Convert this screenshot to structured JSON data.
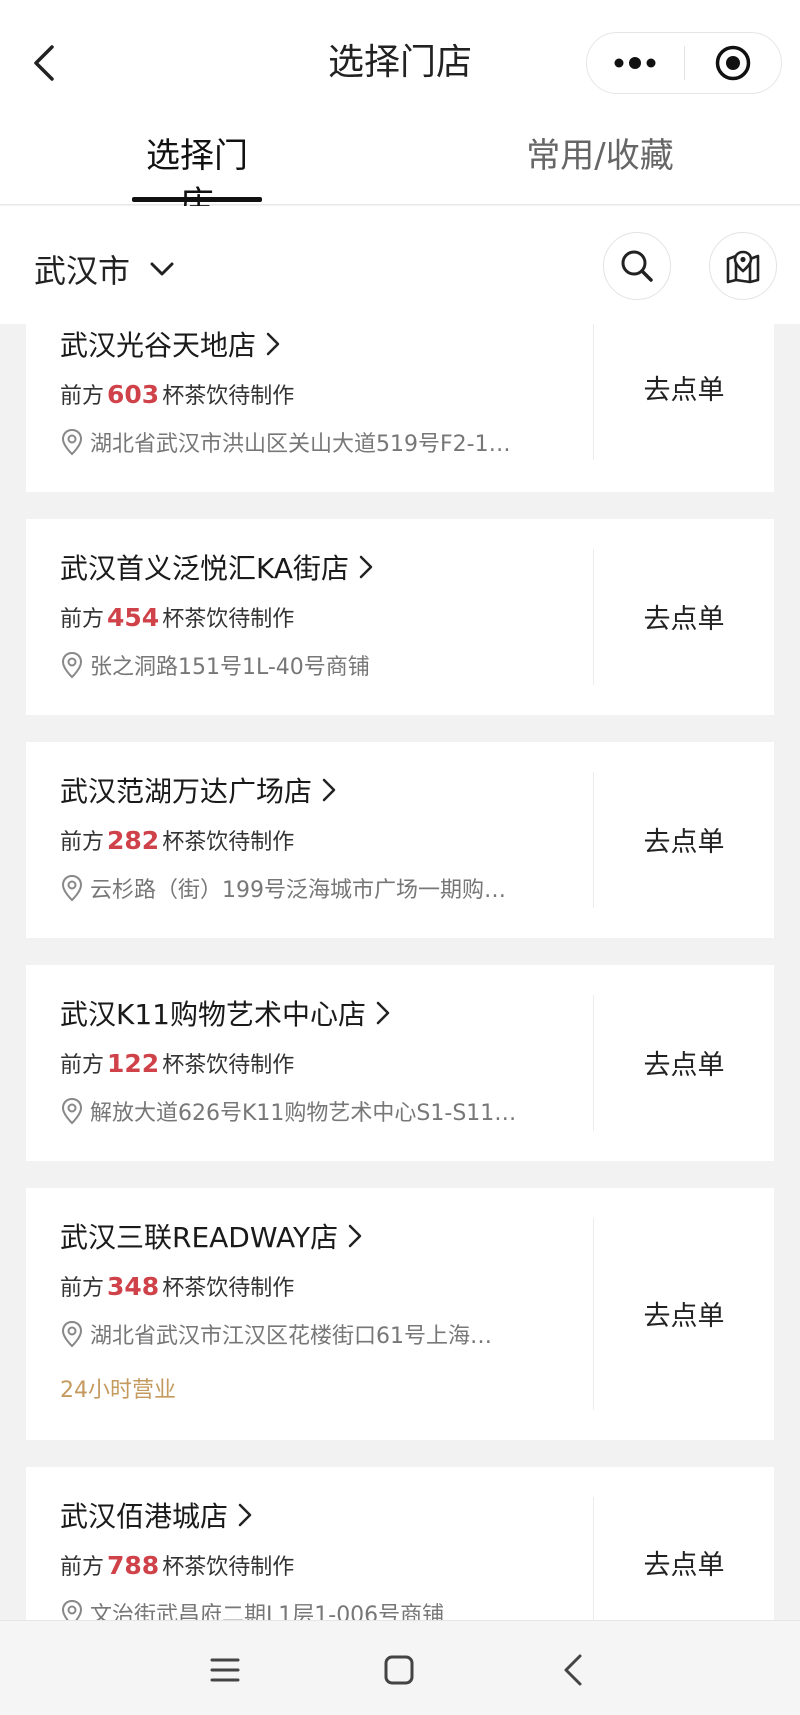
{
  "header": {
    "title": "选择门店"
  },
  "tabs": [
    {
      "label": "选择门店",
      "active": true
    },
    {
      "label": "常用/收藏",
      "active": false
    }
  ],
  "city": {
    "name": "武汉市"
  },
  "queue": {
    "prefix": "前方",
    "suffix": "杯茶饮待制作"
  },
  "order_label": "去点单",
  "stores": [
    {
      "name": "武汉光谷天地店",
      "queue": "603",
      "address": "湖北省武汉市洪山区关山大道519号F2-1…"
    },
    {
      "name": "武汉首义泛悦汇KA街店",
      "queue": "454",
      "address": "张之洞路151号1L-40号商铺"
    },
    {
      "name": "武汉范湖万达广场店",
      "queue": "282",
      "address": "云杉路（街）199号泛海城市广场一期购…"
    },
    {
      "name": "武汉K11购物艺术中心店",
      "queue": "122",
      "address": "解放大道626号K11购物艺术中心S1-S11…"
    },
    {
      "name": "武汉三联READWAY店",
      "queue": "348",
      "address": "湖北省武汉市江汉区花楼街口61号上海…",
      "tag": "24小时营业"
    },
    {
      "name": "武汉佰港城店",
      "queue": "788",
      "address": "文治街武昌府二期L1层1-006号商铺"
    }
  ],
  "colors": {
    "accent": "#d0424a",
    "tag": "#c49a5e",
    "background": "#f2f2f2"
  },
  "icons": {
    "back": "chevron-left-icon",
    "more": "more-dots-icon",
    "close": "target-circle-icon",
    "search": "search-icon",
    "map": "map-pin-icon",
    "nav_menu": "menu-icon",
    "nav_home": "square-icon",
    "nav_back": "chevron-left-icon"
  }
}
